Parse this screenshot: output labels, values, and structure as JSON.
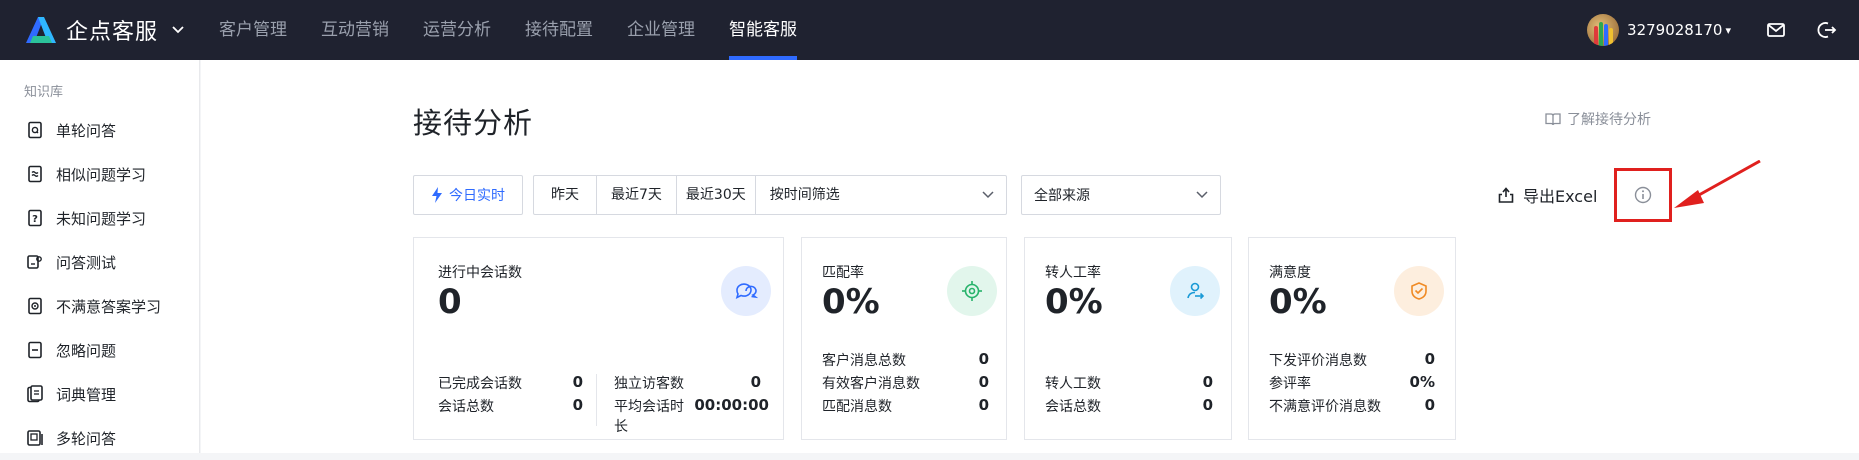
{
  "app": {
    "brand_name": "企点客服",
    "colors": {
      "topbar": "#1f2230",
      "accent": "#2f6bff",
      "highlight_box": "#e0201e"
    }
  },
  "topnav": {
    "items": [
      "客户管理",
      "互动营销",
      "运营分析",
      "接待配置",
      "企业管理",
      "智能客服"
    ],
    "active": "智能客服"
  },
  "user": {
    "name": "3279028170"
  },
  "top_icons": [
    "mail-icon",
    "logout-icon"
  ],
  "sidebar": {
    "section": "知识库",
    "items": [
      {
        "label": "单轮问答",
        "icon": "qa-doc-icon"
      },
      {
        "label": "相似问题学习",
        "icon": "similar-doc-icon"
      },
      {
        "label": "未知问题学习",
        "icon": "question-doc-icon"
      },
      {
        "label": "问答测试",
        "icon": "test-icon"
      },
      {
        "label": "不满意答案学习",
        "icon": "dissatisfied-doc-icon"
      },
      {
        "label": "忽略问题",
        "icon": "ignore-doc-icon"
      },
      {
        "label": "词典管理",
        "icon": "dictionary-icon"
      },
      {
        "label": "多轮问答",
        "icon": "multi-qa-icon"
      }
    ]
  },
  "page": {
    "title": "接待分析",
    "help_link": "了解接待分析"
  },
  "filters": {
    "today_button": "今日实时",
    "ranges": [
      "昨天",
      "最近7天",
      "最近30天"
    ],
    "date_filter": "按时间筛选",
    "source_select": "全部来源",
    "export_button": "导出Excel"
  },
  "cards": {
    "sessions": {
      "title": "进行中会话数",
      "value": "0",
      "stats": [
        {
          "label": "已完成会话数",
          "value": "0"
        },
        {
          "label": "会话总数",
          "value": "0"
        },
        {
          "label": "独立访客数",
          "value": "0"
        },
        {
          "label": "平均会话时长",
          "value": "00:00:00"
        }
      ]
    },
    "match": {
      "title": "匹配率",
      "value": "0%",
      "stats": [
        {
          "label": "客户消息总数",
          "value": "0"
        },
        {
          "label": "有效客户消息数",
          "value": "0"
        },
        {
          "label": "匹配消息数",
          "value": "0"
        }
      ]
    },
    "transfer": {
      "title": "转人工率",
      "value": "0%",
      "stats": [
        {
          "label": "转人工数",
          "value": "0"
        },
        {
          "label": "会话总数",
          "value": "0"
        }
      ]
    },
    "satisfaction": {
      "title": "满意度",
      "value": "0%",
      "stats": [
        {
          "label": "下发评价消息数",
          "value": "0"
        },
        {
          "label": "参评率",
          "value": "0%"
        },
        {
          "label": "不满意评价消息数",
          "value": "0"
        }
      ]
    }
  }
}
